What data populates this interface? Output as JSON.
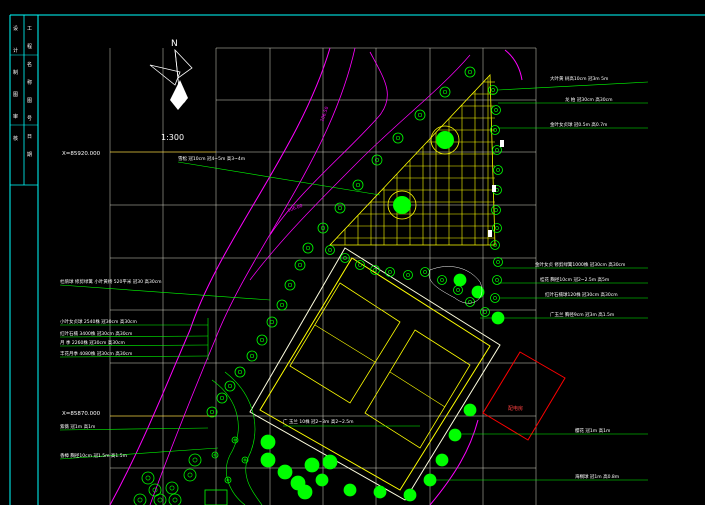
{
  "title_block": {
    "column_a": [
      "设",
      "计",
      "制",
      "图",
      "审",
      "核"
    ],
    "column_b": [
      "工",
      "程",
      "名",
      "称",
      "图",
      "号",
      "日",
      "期"
    ]
  },
  "north_arrow": {
    "label": "N"
  },
  "scale": {
    "text": "1:300"
  },
  "coordinates": {
    "upper": "X=85920.000",
    "lower": "X=85870.000"
  },
  "elevations": [
    "106.50",
    "106.00"
  ],
  "callouts_right": [
    "大叶黄  树高10cm  冠3m  5m",
    "龙  柏  冠30cm  高30cm",
    "金叶女贞球  冠0.5m  高0.7m",
    "金叶女贞 修剪绿篱1000株  冠30cm  高30cm",
    "桂花  胸径10cm  冠2~2.5m  高5m",
    "红叶石楠球120株  冠30cm  高30cm",
    "广玉兰  胸径9cm  冠3m  高1.5m",
    "樱花  冠1m  高1m",
    "海桐球  冠1m  高0.8m"
  ],
  "callouts_left": [
    "雪松  冠10cm  冠4~5m  高3~4m",
    "杜鹃球 修剪绿篱 小叶黄杨 520平米  冠30  高30cm",
    "小叶女贞球 2540株  冠30cm  高30cm",
    "红叶石楠 3400株  冠30cm  高30cm",
    "月  季 2260株  冠30cm  高30cm",
    "丰花月季 4080株  冠30cm  高30cm",
    "紫薇  冠1m  高1m",
    "香樟  胸径10cm  冠1.5m  高1.5m"
  ],
  "callout_court": "广  玉兰 10株  冠2~3m  高2~2.5m",
  "building_label": "配电房",
  "colors": {
    "background": "#000000",
    "frame": "#00ffff",
    "grid": "#ffffe0",
    "magenta": "#ff00ff",
    "plant": "#00ff00",
    "court": "#ffff00",
    "building": "#ff0000",
    "callout_line": "#00ff00"
  }
}
